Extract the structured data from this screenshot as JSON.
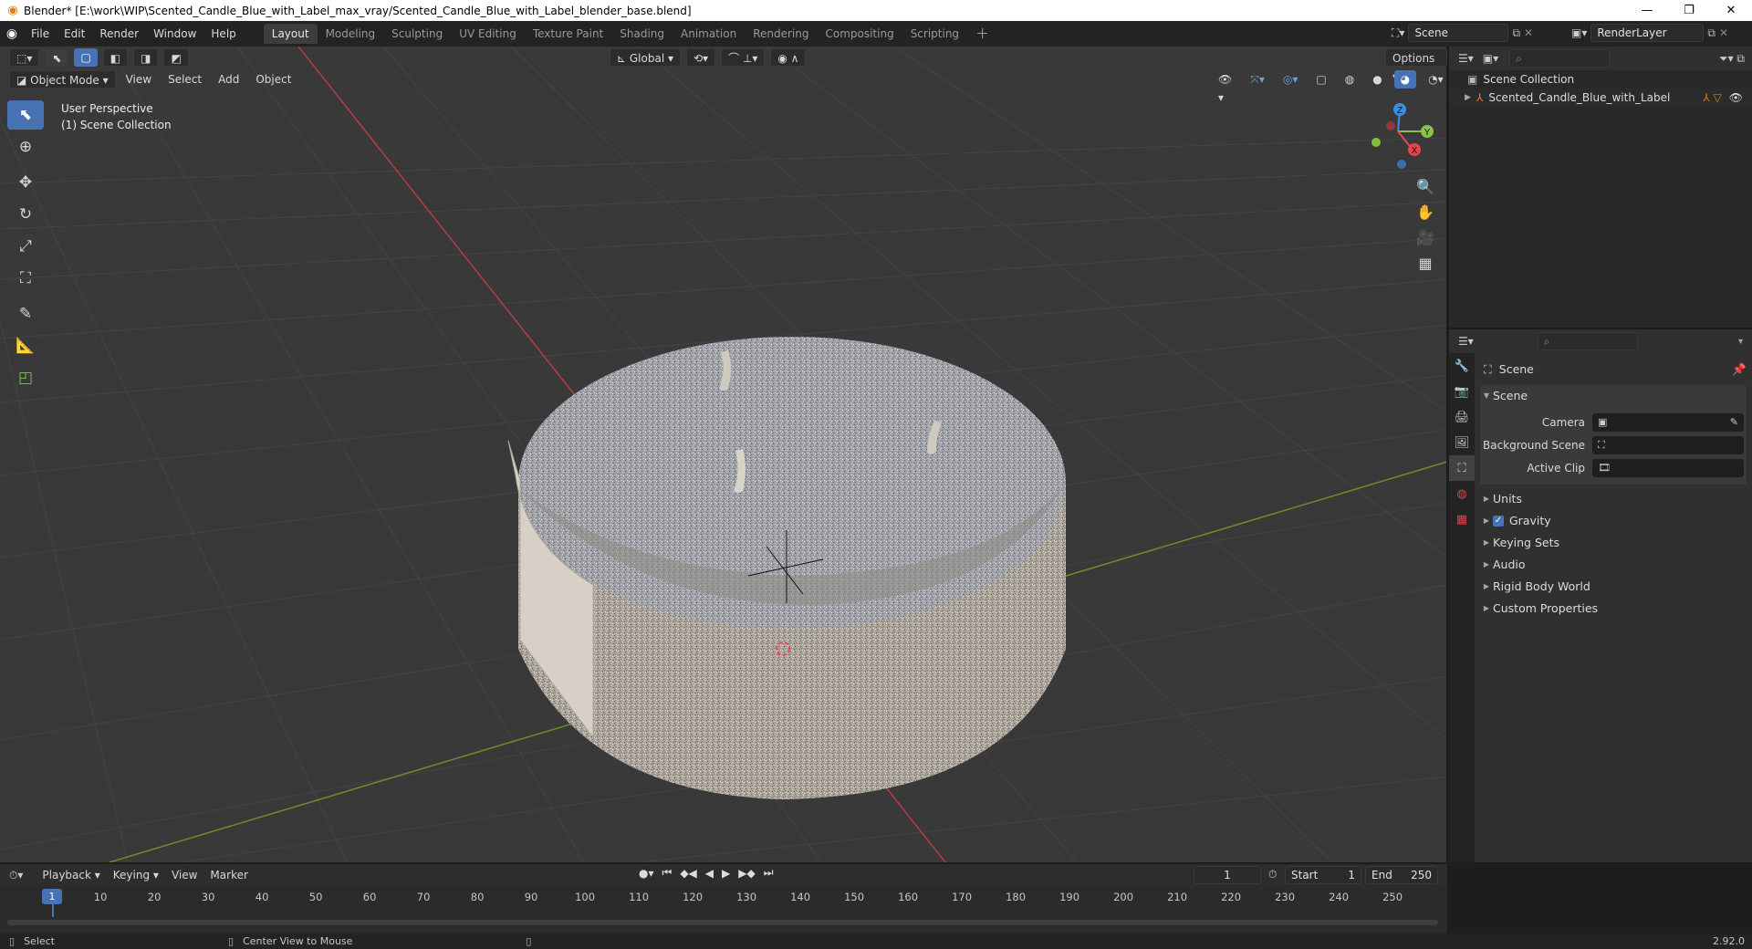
{
  "window": {
    "title": "Blender* [E:\\work\\WIP\\Scented_Candle_Blue_with_Label_max_vray/Scented_Candle_Blue_with_Label_blender_base.blend]",
    "minimize": "—",
    "maximize": "❐",
    "close": "✕"
  },
  "menu": [
    "File",
    "Edit",
    "Render",
    "Window",
    "Help"
  ],
  "workspaces": [
    "Layout",
    "Modeling",
    "Sculpting",
    "UV Editing",
    "Texture Paint",
    "Shading",
    "Animation",
    "Rendering",
    "Compositing",
    "Scripting"
  ],
  "active_workspace": "Layout",
  "scene_field": "Scene",
  "view_layer_field": "RenderLayer",
  "viewport": {
    "mode": "Object Mode",
    "menus": [
      "View",
      "Select",
      "Add",
      "Object"
    ],
    "transform_orientation": "Global",
    "options_label": "Options",
    "overlay_line1": "User Perspective",
    "overlay_line2": "(1) Scene Collection",
    "gizmo": {
      "x": "X",
      "y": "Y",
      "z": "Z"
    }
  },
  "outliner": {
    "root": "Scene Collection",
    "items": [
      {
        "label": "Scented_Candle_Blue_with_Label"
      }
    ]
  },
  "properties": {
    "context_title": "Scene",
    "section_title": "Scene",
    "fields": [
      {
        "label": "Camera",
        "value": ""
      },
      {
        "label": "Background Scene",
        "value": ""
      },
      {
        "label": "Active Clip",
        "value": ""
      }
    ],
    "panels": [
      "Units",
      "Gravity",
      "Keying Sets",
      "Audio",
      "Rigid Body World",
      "Custom Properties"
    ],
    "gravity_enabled": true
  },
  "timeline": {
    "menus": [
      "Playback",
      "Keying",
      "View",
      "Marker"
    ],
    "current_frame": "1",
    "start_label": "Start",
    "start": "1",
    "end_label": "End",
    "end": "250",
    "ticks": [
      "1",
      "10",
      "20",
      "30",
      "40",
      "50",
      "60",
      "70",
      "80",
      "90",
      "100",
      "110",
      "120",
      "130",
      "140",
      "150",
      "160",
      "170",
      "180",
      "190",
      "200",
      "210",
      "220",
      "230",
      "240",
      "250"
    ]
  },
  "statusbar": {
    "left": "Select",
    "middle": "Center View to Mouse",
    "version": "2.92.0"
  },
  "colors": {
    "accent": "#4772b3",
    "x_axis": "#e8434f",
    "y_axis": "#8bc34a",
    "z_axis": "#3e8edf",
    "object_orange": "#e87d0d"
  }
}
